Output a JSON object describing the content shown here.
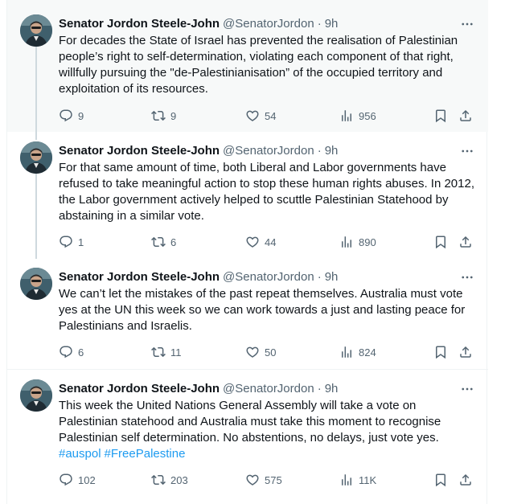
{
  "author": {
    "name": "Senator Jordon Steele-John",
    "handle": "@SenatorJordon",
    "time": "9h"
  },
  "tweets": [
    {
      "text": "For decades the State of Israel has prevented the realisation of Palestinian people’s right to self-determination, violating each component of that right, willfully pursuing the \"de-Palestinianisation” of the occupied territory and exploitation of its resources.",
      "hashtags": [],
      "replies": "9",
      "retweets": "9",
      "likes": "54",
      "views": "956"
    },
    {
      "text": "For that same amount of time, both Liberal and Labor governments have refused to take meaningful action to stop these human rights abuses. In 2012, the Labor government actively helped to scuttle Palestinian Statehood by abstaining in a similar vote.",
      "hashtags": [],
      "replies": "1",
      "retweets": "6",
      "likes": "44",
      "views": "890"
    },
    {
      "text": "We can’t let the mistakes of the past repeat themselves. Australia must vote yes at the UN this week so we can work towards a just and lasting peace for Palestinians and Israelis.",
      "hashtags": [],
      "replies": "6",
      "retweets": "11",
      "likes": "50",
      "views": "824"
    },
    {
      "text": "This week the United Nations General Assembly will take a vote on Palestinian statehood and Australia must take this moment to recognise Palestinian self determination. No abstentions, no delays, just vote yes.",
      "hashtags": [
        "#auspol",
        "#FreePalestine"
      ],
      "replies": "102",
      "retweets": "203",
      "likes": "575",
      "views": "11K"
    }
  ],
  "icons": {
    "more": "more-horizontal-icon",
    "reply": "reply-bubble-icon",
    "retweet": "retweet-icon",
    "like": "heart-icon",
    "views": "views-chart-icon",
    "bookmark": "bookmark-icon",
    "share": "share-icon"
  },
  "colors": {
    "accent": "#1d9bf0",
    "secondary_text": "#536471",
    "primary_text": "#0f1419",
    "highlight_bg": "#f7f9f9",
    "thread_line": "#cfd9de"
  }
}
